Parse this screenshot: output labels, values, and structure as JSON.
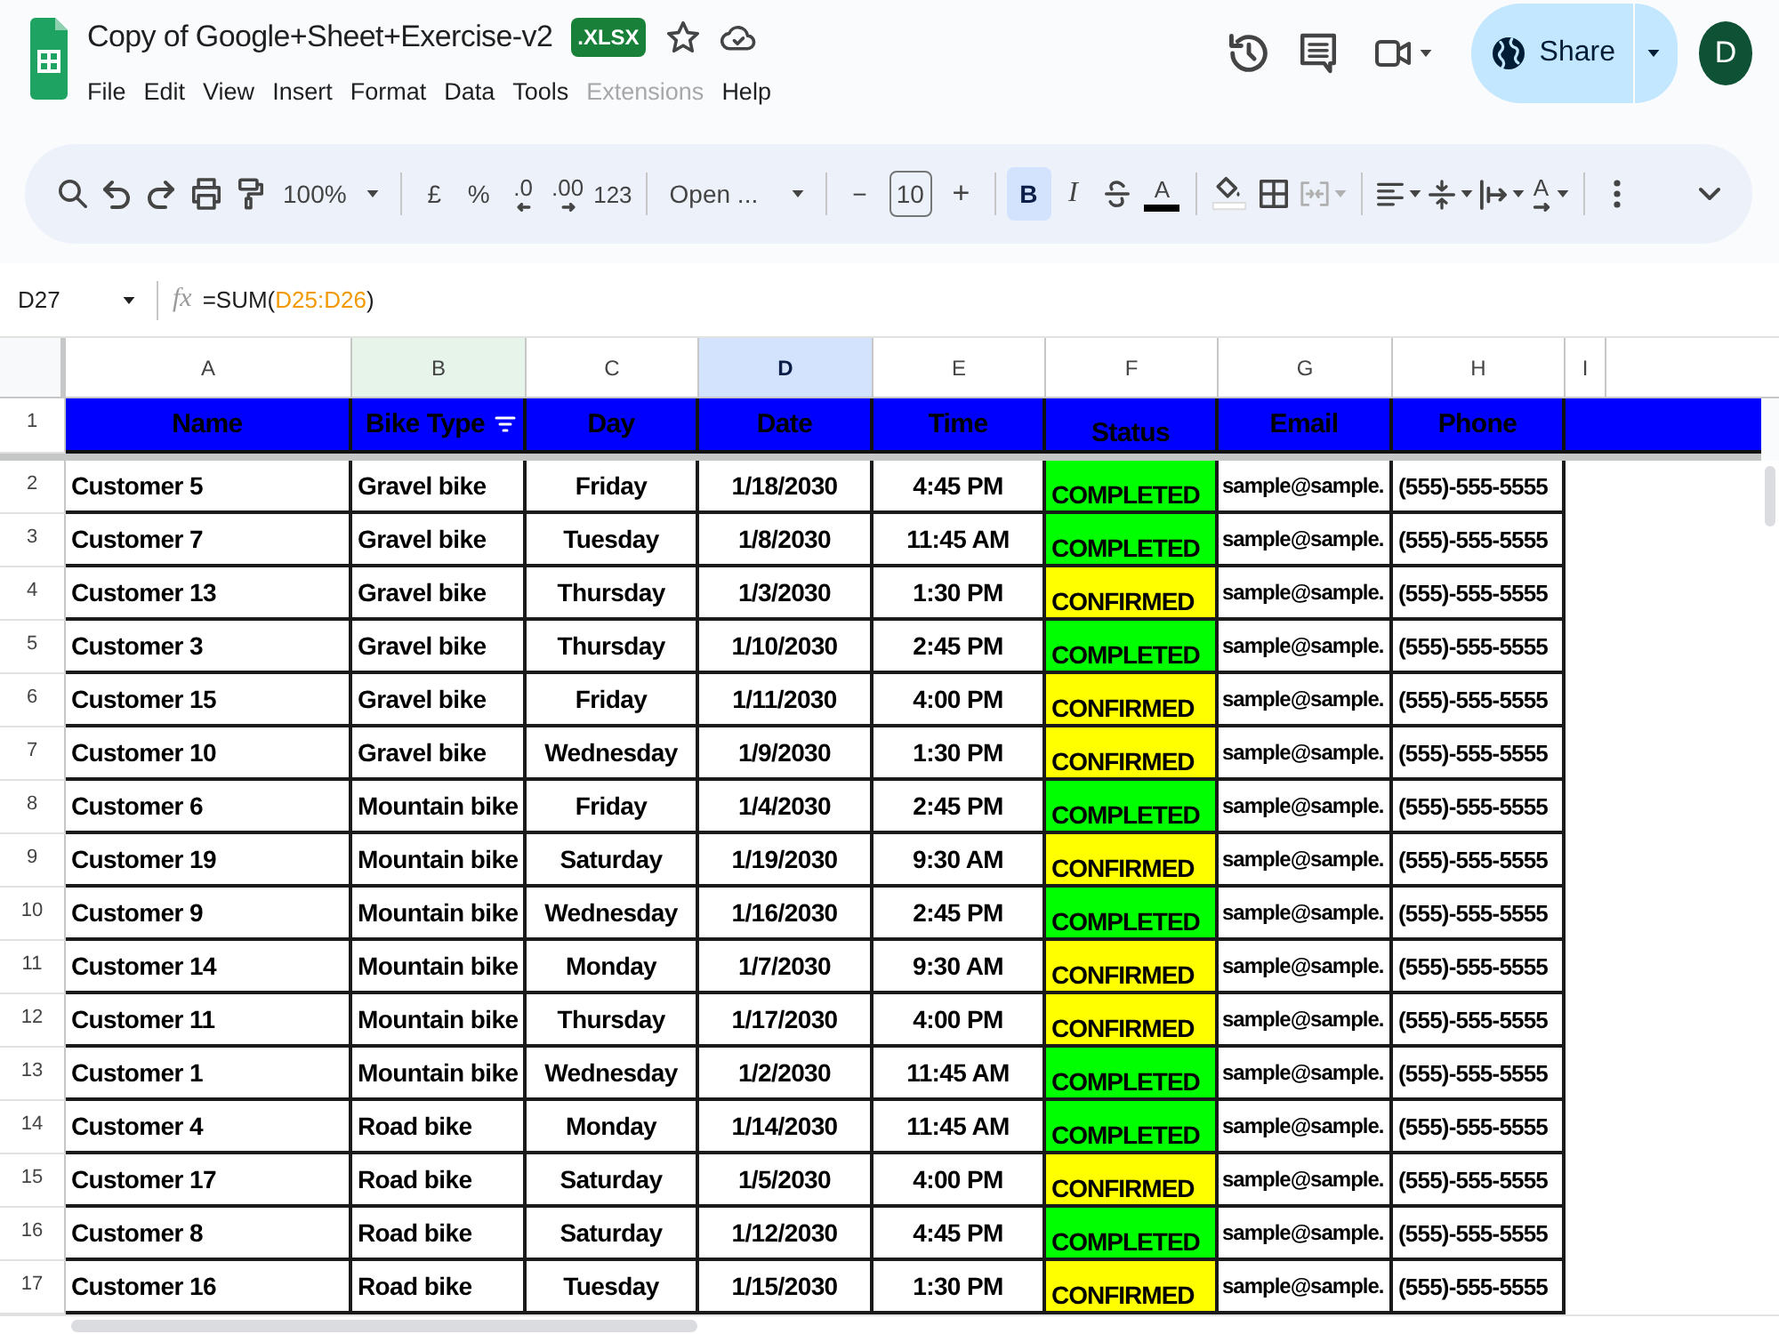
{
  "document": {
    "title": "Copy of Google+Sheet+Exercise-v2",
    "badge": ".XLSX",
    "starred": false
  },
  "menu": [
    {
      "label": "File",
      "disabled": false
    },
    {
      "label": "Edit",
      "disabled": false
    },
    {
      "label": "View",
      "disabled": false
    },
    {
      "label": "Insert",
      "disabled": false
    },
    {
      "label": "Format",
      "disabled": false
    },
    {
      "label": "Data",
      "disabled": false
    },
    {
      "label": "Tools",
      "disabled": false
    },
    {
      "label": "Extensions",
      "disabled": true
    },
    {
      "label": "Help",
      "disabled": false
    }
  ],
  "share_button": {
    "label": "Share"
  },
  "avatar": {
    "initial": "D"
  },
  "toolbar": {
    "zoom": "100%",
    "currency": "£",
    "percent": "%",
    "decrease_decimal": ".0",
    "increase_decimal": ".00",
    "number_format": "123",
    "font": "Open ...",
    "font_size_minus": "−",
    "font_size": "10",
    "font_size_plus": "+",
    "styles": [
      {
        "label": "B",
        "selected": true
      },
      {
        "label": "I",
        "selected": false
      }
    ],
    "text_color": "A",
    "merge_disabled": true,
    "rotation": "A"
  },
  "formula_bar": {
    "cell": "D27",
    "fx": "fx",
    "formula": [
      {
        "kind": "text",
        "text": "=SUM("
      },
      {
        "kind": "range",
        "text": "D25:D26"
      },
      {
        "kind": "text",
        "text": ")"
      }
    ]
  },
  "columns": [
    {
      "label": "A",
      "selected": false,
      "filtered": false
    },
    {
      "label": "B",
      "selected": false,
      "filtered": true
    },
    {
      "label": "C",
      "selected": false,
      "filtered": false
    },
    {
      "label": "D",
      "selected": true,
      "filtered": false
    },
    {
      "label": "E",
      "selected": false,
      "filtered": false
    },
    {
      "label": "F",
      "selected": false,
      "filtered": false
    },
    {
      "label": "G",
      "selected": false,
      "filtered": false
    },
    {
      "label": "H",
      "selected": false,
      "filtered": false
    },
    {
      "label": "I",
      "selected": false,
      "filtered": false
    }
  ],
  "header_row": {
    "number": "1",
    "cells": [
      {
        "text": "Name",
        "filter": false
      },
      {
        "text": "Bike Type",
        "filter": true
      },
      {
        "text": "Day",
        "filter": false
      },
      {
        "text": "Date",
        "filter": false
      },
      {
        "text": "Time",
        "filter": false
      },
      {
        "text": "Status",
        "filter": false
      },
      {
        "text": "Email",
        "filter": false
      },
      {
        "text": "Phone",
        "filter": false
      }
    ]
  },
  "rows": [
    {
      "number": "2",
      "name": "Customer 5",
      "bike_type": "Gravel bike",
      "day": "Friday",
      "date": "1/18/2030",
      "time": "4:45 PM",
      "status": {
        "text": "COMPLETED",
        "color": "#00ff00"
      },
      "email": "sample@sample.",
      "phone": "(555)-555-5555"
    },
    {
      "number": "3",
      "name": "Customer 7",
      "bike_type": "Gravel bike",
      "day": "Tuesday",
      "date": "1/8/2030",
      "time": "11:45 AM",
      "status": {
        "text": "COMPLETED",
        "color": "#00ff00"
      },
      "email": "sample@sample.",
      "phone": "(555)-555-5555"
    },
    {
      "number": "4",
      "name": "Customer 13",
      "bike_type": "Gravel bike",
      "day": "Thursday",
      "date": "1/3/2030",
      "time": "1:30 PM",
      "status": {
        "text": "CONFIRMED",
        "color": "#ffff00"
      },
      "email": "sample@sample.",
      "phone": "(555)-555-5555"
    },
    {
      "number": "5",
      "name": "Customer 3",
      "bike_type": "Gravel bike",
      "day": "Thursday",
      "date": "1/10/2030",
      "time": "2:45 PM",
      "status": {
        "text": "COMPLETED",
        "color": "#00ff00"
      },
      "email": "sample@sample.",
      "phone": "(555)-555-5555"
    },
    {
      "number": "6",
      "name": "Customer 15",
      "bike_type": "Gravel bike",
      "day": "Friday",
      "date": "1/11/2030",
      "time": "4:00 PM",
      "status": {
        "text": "CONFIRMED",
        "color": "#ffff00"
      },
      "email": "sample@sample.",
      "phone": "(555)-555-5555"
    },
    {
      "number": "7",
      "name": "Customer 10",
      "bike_type": "Gravel bike",
      "day": "Wednesday",
      "date": "1/9/2030",
      "time": "1:30 PM",
      "status": {
        "text": "CONFIRMED",
        "color": "#ffff00"
      },
      "email": "sample@sample.",
      "phone": "(555)-555-5555"
    },
    {
      "number": "8",
      "name": "Customer 6",
      "bike_type": "Mountain bike",
      "day": "Friday",
      "date": "1/4/2030",
      "time": "2:45 PM",
      "status": {
        "text": "COMPLETED",
        "color": "#00ff00"
      },
      "email": "sample@sample.",
      "phone": "(555)-555-5555"
    },
    {
      "number": "9",
      "name": "Customer 19",
      "bike_type": "Mountain bike",
      "day": "Saturday",
      "date": "1/19/2030",
      "time": "9:30 AM",
      "status": {
        "text": "CONFIRMED",
        "color": "#ffff00"
      },
      "email": "sample@sample.",
      "phone": "(555)-555-5555"
    },
    {
      "number": "10",
      "name": "Customer 9",
      "bike_type": "Mountain bike",
      "day": "Wednesday",
      "date": "1/16/2030",
      "time": "2:45 PM",
      "status": {
        "text": "COMPLETED",
        "color": "#00ff00"
      },
      "email": "sample@sample.",
      "phone": "(555)-555-5555"
    },
    {
      "number": "11",
      "name": "Customer 14",
      "bike_type": "Mountain bike",
      "day": "Monday",
      "date": "1/7/2030",
      "time": "9:30 AM",
      "status": {
        "text": "CONFIRMED",
        "color": "#ffff00"
      },
      "email": "sample@sample.",
      "phone": "(555)-555-5555"
    },
    {
      "number": "12",
      "name": "Customer 11",
      "bike_type": "Mountain bike",
      "day": "Thursday",
      "date": "1/17/2030",
      "time": "4:00 PM",
      "status": {
        "text": "CONFIRMED",
        "color": "#ffff00"
      },
      "email": "sample@sample.",
      "phone": "(555)-555-5555"
    },
    {
      "number": "13",
      "name": "Customer 1",
      "bike_type": "Mountain bike",
      "day": "Wednesday",
      "date": "1/2/2030",
      "time": "11:45 AM",
      "status": {
        "text": "COMPLETED",
        "color": "#00ff00"
      },
      "email": "sample@sample.",
      "phone": "(555)-555-5555"
    },
    {
      "number": "14",
      "name": "Customer 4",
      "bike_type": "Road bike",
      "day": "Monday",
      "date": "1/14/2030",
      "time": "11:45 AM",
      "status": {
        "text": "COMPLETED",
        "color": "#00ff00"
      },
      "email": "sample@sample.",
      "phone": "(555)-555-5555"
    },
    {
      "number": "15",
      "name": "Customer 17",
      "bike_type": "Road bike",
      "day": "Saturday",
      "date": "1/5/2030",
      "time": "4:00 PM",
      "status": {
        "text": "CONFIRMED",
        "color": "#ffff00"
      },
      "email": "sample@sample.",
      "phone": "(555)-555-5555"
    },
    {
      "number": "16",
      "name": "Customer 8",
      "bike_type": "Road bike",
      "day": "Saturday",
      "date": "1/12/2030",
      "time": "4:45 PM",
      "status": {
        "text": "COMPLETED",
        "color": "#00ff00"
      },
      "email": "sample@sample.",
      "phone": "(555)-555-5555"
    },
    {
      "number": "17",
      "name": "Customer 16",
      "bike_type": "Road bike",
      "day": "Tuesday",
      "date": "1/15/2030",
      "time": "1:30 PM",
      "status": {
        "text": "CONFIRMED",
        "color": "#ffff00"
      },
      "email": "sample@sample.",
      "phone": "(555)-555-5555"
    }
  ]
}
